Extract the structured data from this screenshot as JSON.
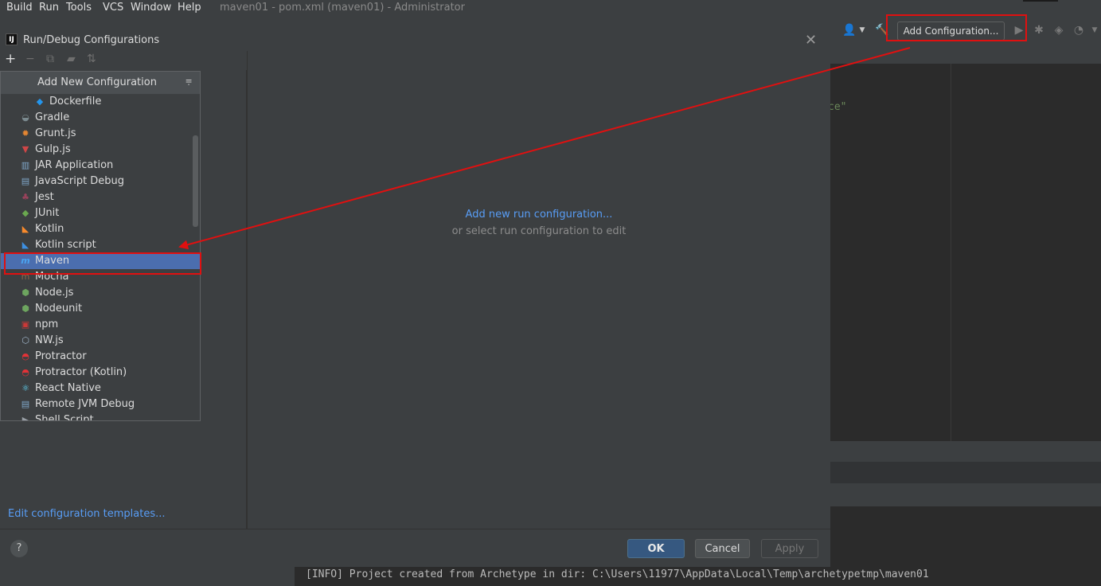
{
  "menubar": {
    "items": [
      "Build",
      "Run",
      "Tools",
      "VCS",
      "Window",
      "Help"
    ],
    "window_title": "maven01 - pom.xml (maven01) - Administrator"
  },
  "toolbar": {
    "add_configuration_label": "Add Configuration..."
  },
  "editor": {
    "code_fragment": "ce\""
  },
  "console": {
    "line": "[INFO] Project created from Archetype in dir: C:\\Users\\11977\\AppData\\Local\\Temp\\archetypetmp\\maven01"
  },
  "dialog": {
    "logo_text": "IJ",
    "title": "Run/Debug Configurations",
    "close_glyph": "✕",
    "toolbar_glyphs": {
      "add": "+",
      "remove": "−",
      "copy": "⧉",
      "folder": "▰",
      "sort": "⇅"
    },
    "empty_state": {
      "link": "Add new run configuration...",
      "hint": "or select run configuration to edit"
    },
    "edit_templates_link": "Edit configuration templates...",
    "help_label": "?",
    "buttons": {
      "ok": "OK",
      "cancel": "Cancel",
      "apply": "Apply"
    }
  },
  "popup": {
    "header": "Add New Configuration",
    "header_icon": "collapse-icon",
    "items": [
      {
        "label": "Dockerfile",
        "icon": "docker-icon",
        "glyph": "◆",
        "color": "#2496ed",
        "indent": true
      },
      {
        "label": "Gradle",
        "icon": "gradle-icon",
        "glyph": "◒",
        "color": "#7b8a8f"
      },
      {
        "label": "Grunt.js",
        "icon": "grunt-icon",
        "glyph": "✹",
        "color": "#e48632"
      },
      {
        "label": "Gulp.js",
        "icon": "gulp-icon",
        "glyph": "▼",
        "color": "#cf4647"
      },
      {
        "label": "JAR Application",
        "icon": "jar-icon",
        "glyph": "▥",
        "color": "#7fa7c9"
      },
      {
        "label": "JavaScript Debug",
        "icon": "js-debug-icon",
        "glyph": "▤",
        "color": "#7fa7c9"
      },
      {
        "label": "Jest",
        "icon": "jest-icon",
        "glyph": "♣",
        "color": "#99425b"
      },
      {
        "label": "JUnit",
        "icon": "junit-icon",
        "glyph": "◆",
        "color": "#6aa84f"
      },
      {
        "label": "Kotlin",
        "icon": "kotlin-icon",
        "glyph": "◣",
        "color": "#f88a2c"
      },
      {
        "label": "Kotlin script",
        "icon": "kotlin-script-icon",
        "glyph": "◣",
        "color": "#3d8fe0"
      },
      {
        "label": "Maven",
        "icon": "maven-icon",
        "glyph": "m",
        "color": "#4aa3f0",
        "selected": true
      },
      {
        "label": "Mocha",
        "icon": "mocha-icon",
        "glyph": "m",
        "color": "#8d6748"
      },
      {
        "label": "Node.js",
        "icon": "nodejs-icon",
        "glyph": "⬢",
        "color": "#6da55f"
      },
      {
        "label": "Nodeunit",
        "icon": "nodeunit-icon",
        "glyph": "⬢",
        "color": "#6da55f"
      },
      {
        "label": "npm",
        "icon": "npm-icon",
        "glyph": "▣",
        "color": "#cb3837"
      },
      {
        "label": "NW.js",
        "icon": "nwjs-icon",
        "glyph": "⬡",
        "color": "#9fb3c8"
      },
      {
        "label": "Protractor",
        "icon": "protractor-icon",
        "glyph": "◓",
        "color": "#e23237"
      },
      {
        "label": "Protractor (Kotlin)",
        "icon": "protractor-kotlin-icon",
        "glyph": "◓",
        "color": "#e23237"
      },
      {
        "label": "React Native",
        "icon": "react-icon",
        "glyph": "⚛",
        "color": "#61dafb"
      },
      {
        "label": "Remote JVM Debug",
        "icon": "remote-debug-icon",
        "glyph": "▤",
        "color": "#7fa7c9"
      },
      {
        "label": "Shell Script",
        "icon": "shell-icon",
        "glyph": "▶",
        "color": "#9aa0a6"
      }
    ]
  },
  "colors": {
    "highlight_red": "#e01010",
    "selection_blue": "#4b6eaf",
    "link_blue": "#589df6"
  }
}
